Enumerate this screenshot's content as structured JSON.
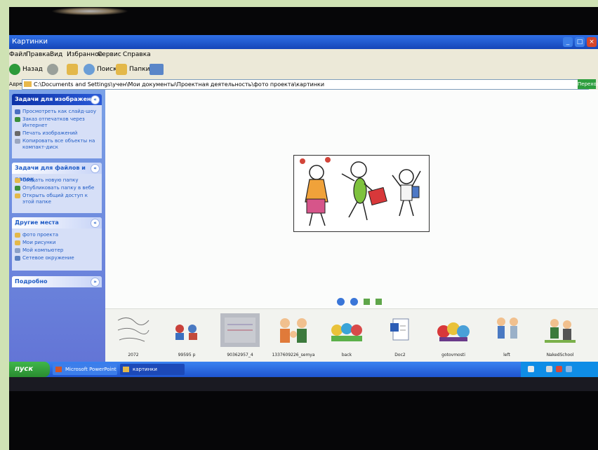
{
  "window": {
    "title": "Картинки",
    "menu": [
      "Файл",
      "Правка",
      "Вид",
      "Избранное",
      "Сервис",
      "Справка"
    ]
  },
  "toolbar": {
    "back_label": "Назад",
    "search_label": "Поиск",
    "folders_label": "Папки"
  },
  "address": {
    "label": "Адрес:",
    "path": "C:\\Documents and Settings\\учен\\Мои документы\\Проектная деятельность\\фото проекта\\картинки",
    "go_label": "Переход"
  },
  "sidebar": {
    "image_tasks": {
      "title": "Задачи для изображений",
      "items": [
        "Просмотреть как слайд-шоу",
        "Заказ отпечатков через Интернет",
        "Печать изображений",
        "Копировать все объекты на компакт-диск"
      ]
    },
    "file_tasks": {
      "title": "Задачи для файлов и папок",
      "items": [
        "Создать новую папку",
        "Опубликовать папку в вебе",
        "Открыть общий доступ к этой папке"
      ]
    },
    "other_places": {
      "title": "Другие места",
      "items": [
        "фото проекта",
        "Мои рисунки",
        "Мой компьютер",
        "Сетевое окружение"
      ]
    },
    "details": {
      "title": "Подробно"
    }
  },
  "filmstrip": {
    "items": [
      {
        "name": "2072"
      },
      {
        "name": "99595 p"
      },
      {
        "name": "90362957_4"
      },
      {
        "name": "1337609226_semya"
      },
      {
        "name": "back"
      },
      {
        "name": "Doc2"
      },
      {
        "name": "gotovmosti"
      },
      {
        "name": "left"
      },
      {
        "name": "NakedSchool"
      }
    ]
  },
  "taskbar": {
    "start_label": "пуск",
    "tasks": [
      "Microsoft PowerPoint",
      "картинки"
    ],
    "colors": {
      "bar": "#1f55d0",
      "start": "#2a8c30",
      "tray": "#0f8de6"
    }
  }
}
